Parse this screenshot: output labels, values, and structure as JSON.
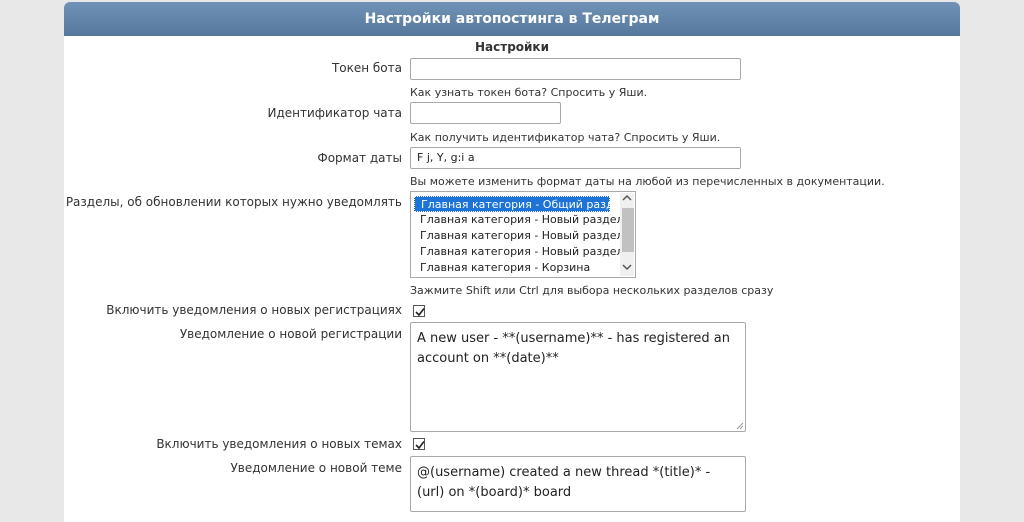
{
  "header": {
    "title": "Настройки автопостинга в Телеграм"
  },
  "section": {
    "title": "Настройки"
  },
  "fields": {
    "bot_token": {
      "label": "Токен бота",
      "value": "",
      "hint": "Как узнать токен бота? Спросить у Яши."
    },
    "chat_id": {
      "label": "Идентификатор чата",
      "value": "",
      "hint": "Как получить идентификатор чата? Спросить у Яши."
    },
    "date_format": {
      "label": "Формат даты",
      "value": "F j, Y, g:i a",
      "hint": "Вы можете изменить формат даты на любой из перечисленных в документации."
    },
    "sections": {
      "label": "Разделы, об обновлении которых нужно уведомлять",
      "options": [
        "Главная категория - Общий раздел",
        "Главная категория - Новый раздел",
        "Главная категория - Новый раздел",
        "Главная категория - Новый раздел",
        "Главная категория - Корзина"
      ],
      "selected_index": 0,
      "hint": "Зажмите Shift или Ctrl для выбора нескольких разделов сразу"
    },
    "notify_registrations": {
      "label": "Включить уведомления о новых регистрациях",
      "checked": true
    },
    "registration_message": {
      "label": "Уведомление о новой регистрации",
      "value": "A new user - **(username)** - has registered an account on **(date)**"
    },
    "notify_topics": {
      "label": "Включить уведомления о новых темах",
      "checked": true
    },
    "topic_message": {
      "label": "Уведомление о новой теме",
      "value": "@(username) created a new thread *(title)* - (url) on *(board)* board"
    }
  },
  "icons": {
    "checkbox_check": "check-icon",
    "scroll_up": "chevron-up-icon",
    "scroll_down": "chevron-down-icon",
    "resize": "resize-grip-icon"
  },
  "colors": {
    "header_bg": "#5f83a8",
    "selected_option": "#1e73d6"
  }
}
